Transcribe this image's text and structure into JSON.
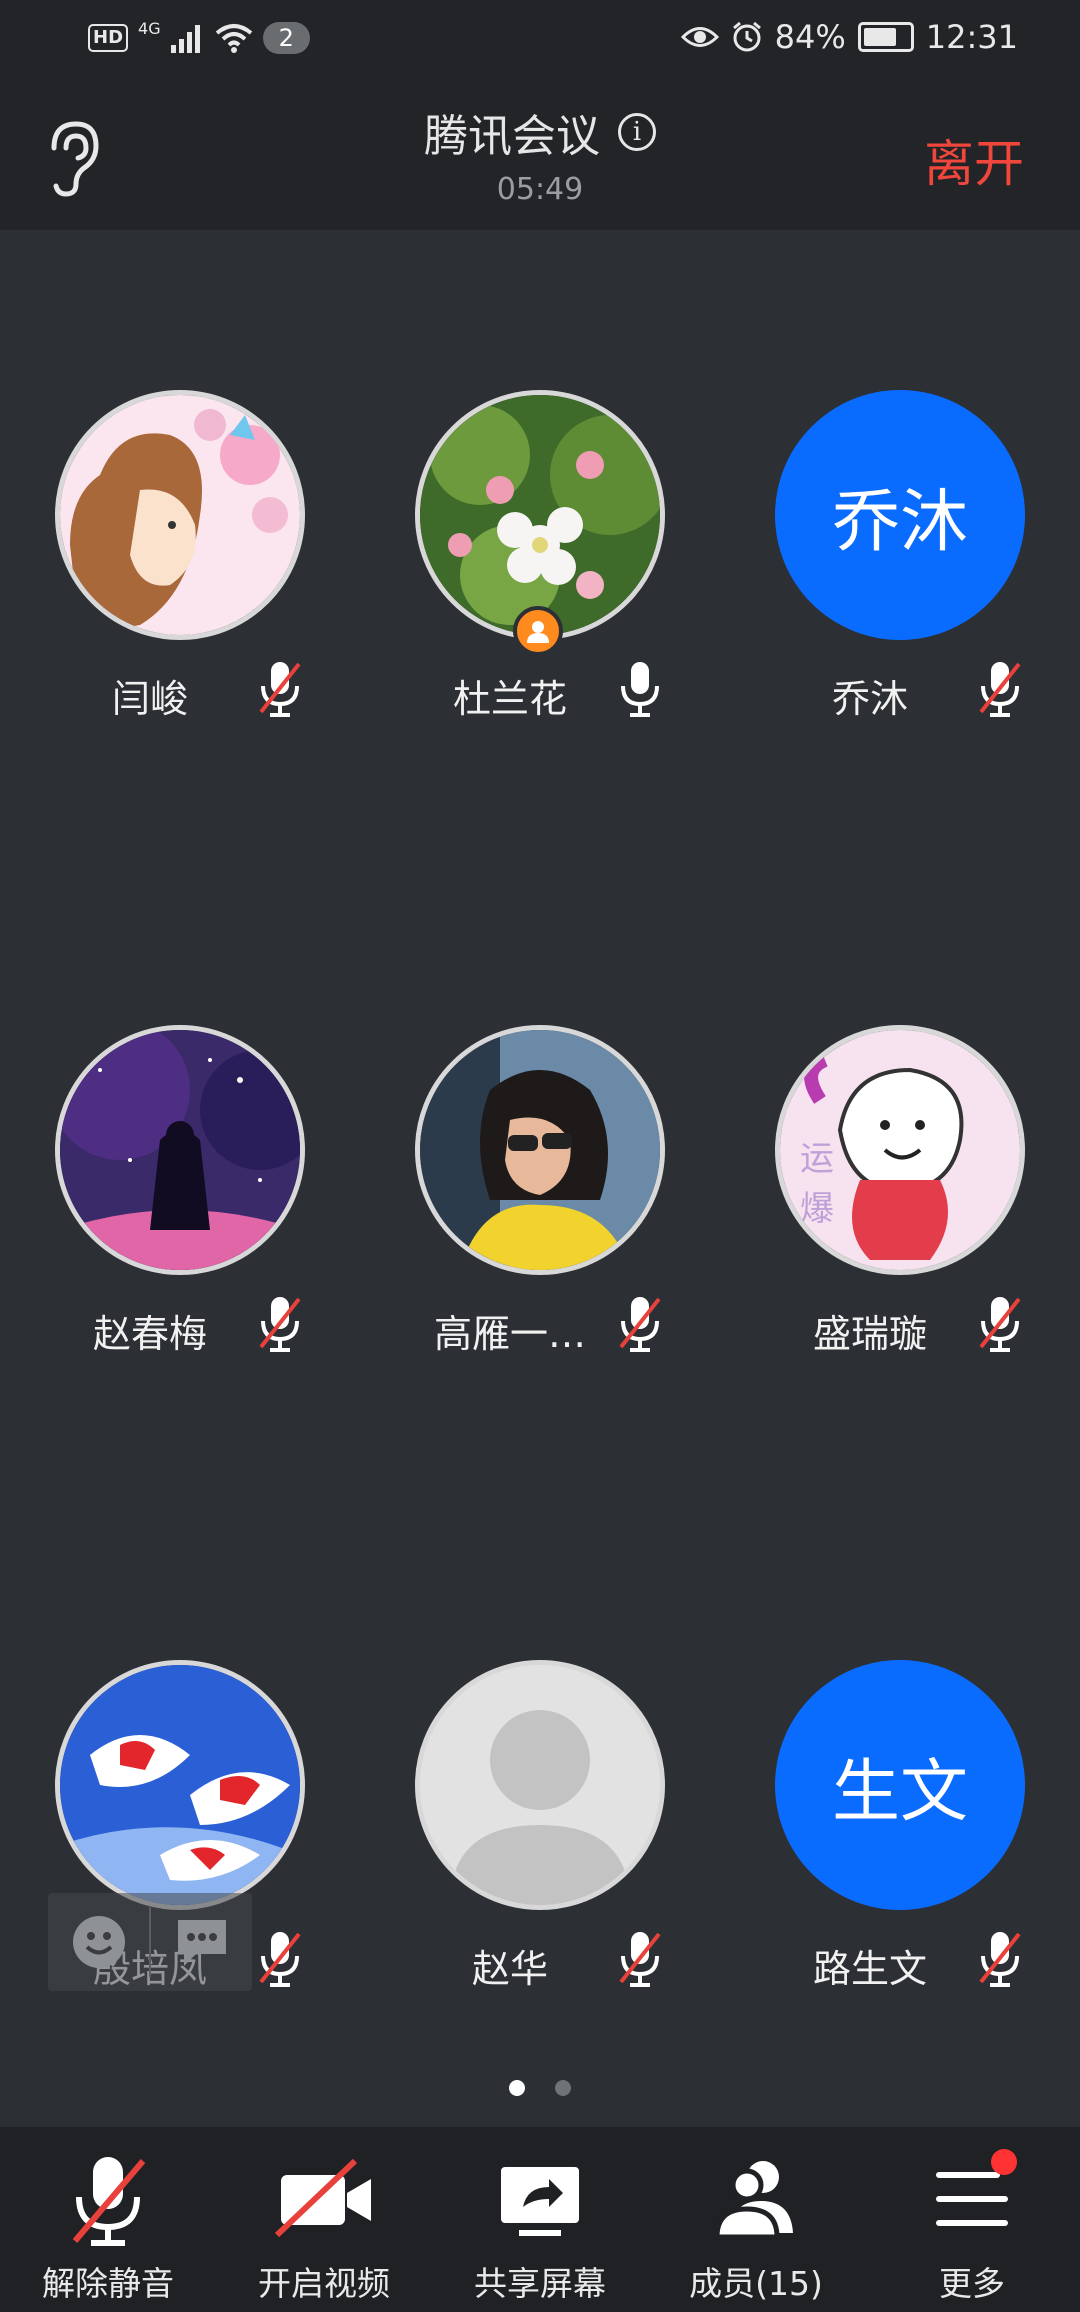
{
  "status_bar": {
    "hd": "HD",
    "network": "4G",
    "notification_count": "2",
    "battery": "84%",
    "battery_level": 0.84,
    "time": "12:31"
  },
  "header": {
    "title": "腾讯会议",
    "timer": "05:49",
    "leave": "离开"
  },
  "participants": [
    {
      "name": "闫峻",
      "avatar_text": "",
      "muted": true
    },
    {
      "name": "杜兰花",
      "avatar_text": "",
      "muted": false,
      "host": true
    },
    {
      "name": "乔沐",
      "avatar_text": "乔沐",
      "muted": true
    },
    {
      "name": "赵春梅",
      "avatar_text": "",
      "muted": true
    },
    {
      "name": "高雁一…",
      "avatar_text": "",
      "muted": true
    },
    {
      "name": "盛瑞璇",
      "avatar_text": "",
      "muted": true
    },
    {
      "name": "殷培凤",
      "avatar_text": "",
      "muted": true
    },
    {
      "name": "赵华",
      "avatar_text": "",
      "muted": true
    },
    {
      "name": "路生文",
      "avatar_text": "生文",
      "muted": true
    }
  ],
  "pager": {
    "pages": 2,
    "current": 1
  },
  "toolbar": {
    "unmute": "解除静音",
    "video": "开启视频",
    "share": "共享屏幕",
    "members": "成员(15)",
    "more": "更多"
  },
  "colors": {
    "accent": "#0a6cff",
    "leave": "#f0463c",
    "host": "#ff8a1d"
  }
}
